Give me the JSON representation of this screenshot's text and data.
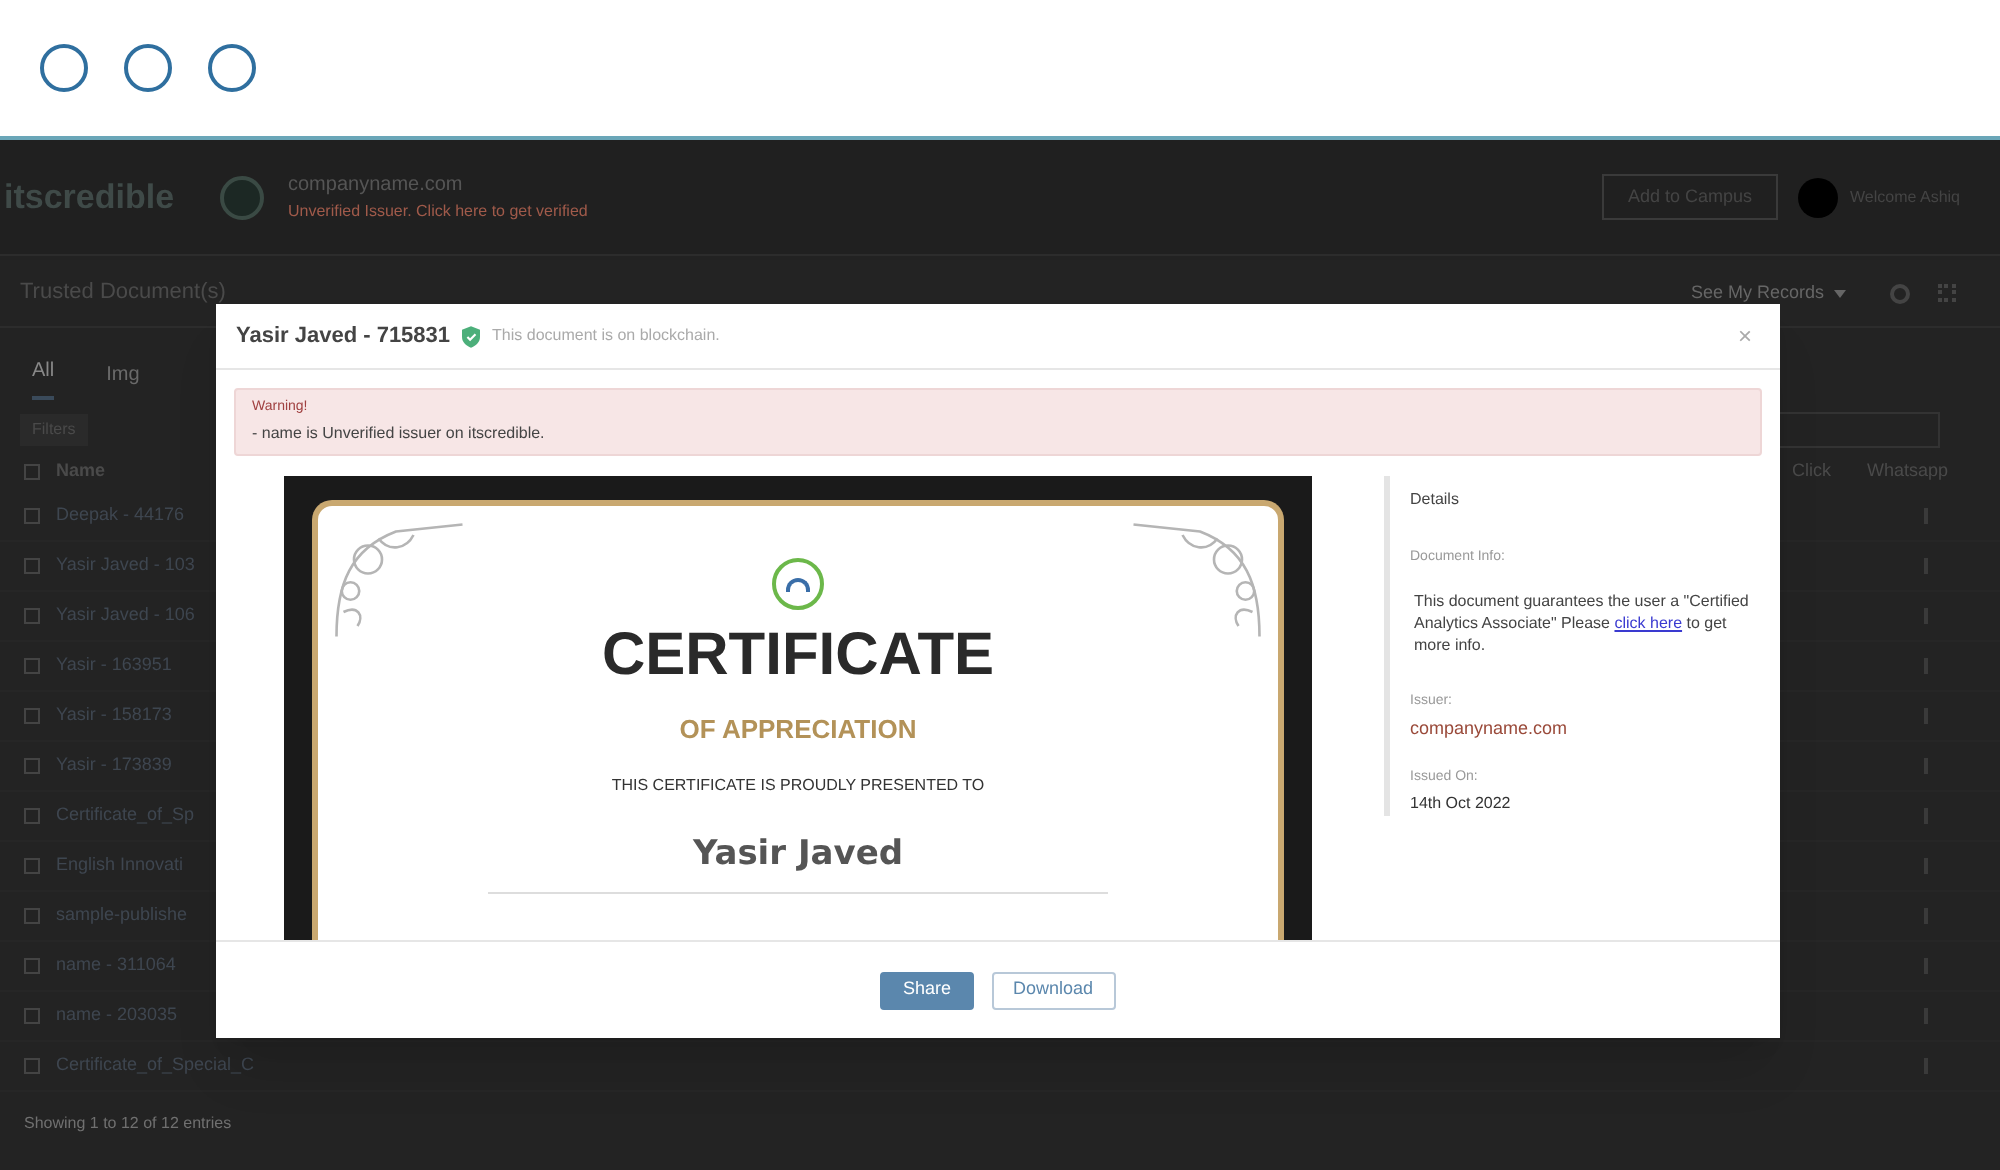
{
  "window_controls": [
    {
      "kind": "circle"
    },
    {
      "kind": "circle"
    },
    {
      "kind": "circle"
    }
  ],
  "header": {
    "logo": "itscredible",
    "org_name": "companyname.com",
    "org_status": "Unverified Issuer. Click here to get verified",
    "action_button": "Add to Campus",
    "user_name": "Welcome Ashiq"
  },
  "documents": {
    "title": "Trusted Document(s)",
    "records_menu": "See My Records",
    "tabs": [
      {
        "label": "All",
        "selected": true
      },
      {
        "label": "Img",
        "selected": false
      }
    ],
    "filters_button": "Filters",
    "select_all_checked": false,
    "columns": {
      "name": "Name",
      "click": "Click",
      "whatsapp": "Whatsapp"
    },
    "rows": [
      {
        "name": "Deepak - 44176",
        "checked": false
      },
      {
        "name": "Yasir Javed - 103",
        "checked": false
      },
      {
        "name": "Yasir Javed - 106",
        "checked": false
      },
      {
        "name": "Yasir - 163951",
        "checked": false
      },
      {
        "name": "Yasir - 158173",
        "checked": false
      },
      {
        "name": "Yasir - 173839",
        "checked": false
      },
      {
        "name": "Certificate_of_Sp",
        "checked": false
      },
      {
        "name": "English Innovati",
        "checked": false
      },
      {
        "name": "sample-publishe",
        "checked": false
      },
      {
        "name": "name - 311064",
        "checked": false
      },
      {
        "name": "name - 203035",
        "checked": false
      },
      {
        "name": "Certificate_of_Special_C",
        "checked": false
      }
    ],
    "footer": "Showing 1 to 12 of 12 entries"
  },
  "modal": {
    "title": "Yasir Javed - 715831",
    "blockchain_note": "This document is on blockchain.",
    "close": "×",
    "warning": {
      "heading": "Warning!",
      "message": "- name is Unverified issuer on itscredible."
    },
    "certificate": {
      "title": "CERTIFICATE",
      "subtitle": "OF APPRECIATION",
      "presented_to": "THIS CERTIFICATE IS PROUDLY PRESENTED TO",
      "recipient": "Yasir Javed"
    },
    "details": {
      "heading": "Details",
      "document_info_label": "Document Info:",
      "info_before": "This document guarantees the user a \"Certified Analytics Associate\" Please",
      "info_link": "click here",
      "info_after": "to get more info.",
      "issuer_label": "Issuer:",
      "issuer": "companyname.com",
      "issued_on_label": "Issued On:",
      "issued_on": "14th Oct 2022"
    },
    "buttons": [
      {
        "label": "Share",
        "kind": "primary"
      },
      {
        "label": "Download",
        "kind": "outline"
      }
    ]
  }
}
